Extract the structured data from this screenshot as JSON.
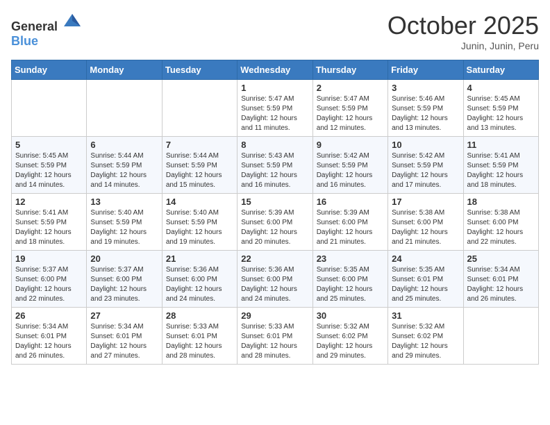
{
  "header": {
    "logo_general": "General",
    "logo_blue": "Blue",
    "month": "October 2025",
    "location": "Junin, Junin, Peru"
  },
  "weekdays": [
    "Sunday",
    "Monday",
    "Tuesday",
    "Wednesday",
    "Thursday",
    "Friday",
    "Saturday"
  ],
  "weeks": [
    [
      {
        "day": "",
        "info": ""
      },
      {
        "day": "",
        "info": ""
      },
      {
        "day": "",
        "info": ""
      },
      {
        "day": "1",
        "info": "Sunrise: 5:47 AM\nSunset: 5:59 PM\nDaylight: 12 hours\nand 11 minutes."
      },
      {
        "day": "2",
        "info": "Sunrise: 5:47 AM\nSunset: 5:59 PM\nDaylight: 12 hours\nand 12 minutes."
      },
      {
        "day": "3",
        "info": "Sunrise: 5:46 AM\nSunset: 5:59 PM\nDaylight: 12 hours\nand 13 minutes."
      },
      {
        "day": "4",
        "info": "Sunrise: 5:45 AM\nSunset: 5:59 PM\nDaylight: 12 hours\nand 13 minutes."
      }
    ],
    [
      {
        "day": "5",
        "info": "Sunrise: 5:45 AM\nSunset: 5:59 PM\nDaylight: 12 hours\nand 14 minutes."
      },
      {
        "day": "6",
        "info": "Sunrise: 5:44 AM\nSunset: 5:59 PM\nDaylight: 12 hours\nand 14 minutes."
      },
      {
        "day": "7",
        "info": "Sunrise: 5:44 AM\nSunset: 5:59 PM\nDaylight: 12 hours\nand 15 minutes."
      },
      {
        "day": "8",
        "info": "Sunrise: 5:43 AM\nSunset: 5:59 PM\nDaylight: 12 hours\nand 16 minutes."
      },
      {
        "day": "9",
        "info": "Sunrise: 5:42 AM\nSunset: 5:59 PM\nDaylight: 12 hours\nand 16 minutes."
      },
      {
        "day": "10",
        "info": "Sunrise: 5:42 AM\nSunset: 5:59 PM\nDaylight: 12 hours\nand 17 minutes."
      },
      {
        "day": "11",
        "info": "Sunrise: 5:41 AM\nSunset: 5:59 PM\nDaylight: 12 hours\nand 18 minutes."
      }
    ],
    [
      {
        "day": "12",
        "info": "Sunrise: 5:41 AM\nSunset: 5:59 PM\nDaylight: 12 hours\nand 18 minutes."
      },
      {
        "day": "13",
        "info": "Sunrise: 5:40 AM\nSunset: 5:59 PM\nDaylight: 12 hours\nand 19 minutes."
      },
      {
        "day": "14",
        "info": "Sunrise: 5:40 AM\nSunset: 5:59 PM\nDaylight: 12 hours\nand 19 minutes."
      },
      {
        "day": "15",
        "info": "Sunrise: 5:39 AM\nSunset: 6:00 PM\nDaylight: 12 hours\nand 20 minutes."
      },
      {
        "day": "16",
        "info": "Sunrise: 5:39 AM\nSunset: 6:00 PM\nDaylight: 12 hours\nand 21 minutes."
      },
      {
        "day": "17",
        "info": "Sunrise: 5:38 AM\nSunset: 6:00 PM\nDaylight: 12 hours\nand 21 minutes."
      },
      {
        "day": "18",
        "info": "Sunrise: 5:38 AM\nSunset: 6:00 PM\nDaylight: 12 hours\nand 22 minutes."
      }
    ],
    [
      {
        "day": "19",
        "info": "Sunrise: 5:37 AM\nSunset: 6:00 PM\nDaylight: 12 hours\nand 22 minutes."
      },
      {
        "day": "20",
        "info": "Sunrise: 5:37 AM\nSunset: 6:00 PM\nDaylight: 12 hours\nand 23 minutes."
      },
      {
        "day": "21",
        "info": "Sunrise: 5:36 AM\nSunset: 6:00 PM\nDaylight: 12 hours\nand 24 minutes."
      },
      {
        "day": "22",
        "info": "Sunrise: 5:36 AM\nSunset: 6:00 PM\nDaylight: 12 hours\nand 24 minutes."
      },
      {
        "day": "23",
        "info": "Sunrise: 5:35 AM\nSunset: 6:00 PM\nDaylight: 12 hours\nand 25 minutes."
      },
      {
        "day": "24",
        "info": "Sunrise: 5:35 AM\nSunset: 6:01 PM\nDaylight: 12 hours\nand 25 minutes."
      },
      {
        "day": "25",
        "info": "Sunrise: 5:34 AM\nSunset: 6:01 PM\nDaylight: 12 hours\nand 26 minutes."
      }
    ],
    [
      {
        "day": "26",
        "info": "Sunrise: 5:34 AM\nSunset: 6:01 PM\nDaylight: 12 hours\nand 26 minutes."
      },
      {
        "day": "27",
        "info": "Sunrise: 5:34 AM\nSunset: 6:01 PM\nDaylight: 12 hours\nand 27 minutes."
      },
      {
        "day": "28",
        "info": "Sunrise: 5:33 AM\nSunset: 6:01 PM\nDaylight: 12 hours\nand 28 minutes."
      },
      {
        "day": "29",
        "info": "Sunrise: 5:33 AM\nSunset: 6:01 PM\nDaylight: 12 hours\nand 28 minutes."
      },
      {
        "day": "30",
        "info": "Sunrise: 5:32 AM\nSunset: 6:02 PM\nDaylight: 12 hours\nand 29 minutes."
      },
      {
        "day": "31",
        "info": "Sunrise: 5:32 AM\nSunset: 6:02 PM\nDaylight: 12 hours\nand 29 minutes."
      },
      {
        "day": "",
        "info": ""
      }
    ]
  ]
}
